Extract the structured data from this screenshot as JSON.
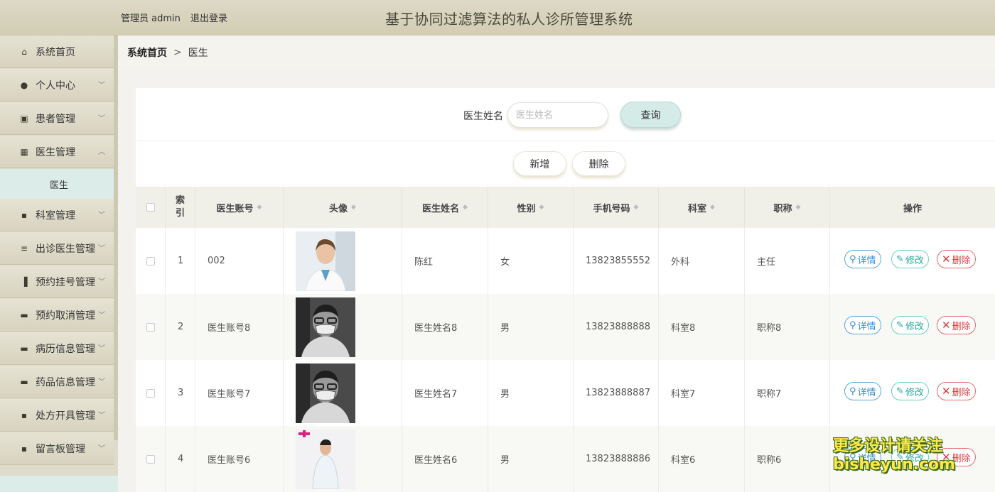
{
  "header": {
    "user_label": "管理员 admin",
    "logout_label": "退出登录",
    "title": "基于协同过滤算法的私人诊所管理系统"
  },
  "sidebar": {
    "items": [
      {
        "label": "系统首页",
        "icon": "home-icon",
        "glyph": "⌂"
      },
      {
        "label": "个人中心",
        "icon": "user-icon",
        "glyph": "●"
      },
      {
        "label": "患者管理",
        "icon": "clipboard-check-icon",
        "glyph": "▣"
      },
      {
        "label": "医生管理",
        "icon": "grid-icon",
        "glyph": "▦"
      },
      {
        "label": "科室管理",
        "icon": "apps-icon",
        "glyph": "▪"
      },
      {
        "label": "出诊医生管理",
        "icon": "list-icon",
        "glyph": "≡"
      },
      {
        "label": "预约挂号管理",
        "icon": "book-icon",
        "glyph": "▐"
      },
      {
        "label": "预约取消管理",
        "icon": "message-icon",
        "glyph": "▬"
      },
      {
        "label": "病历信息管理",
        "icon": "folder-icon",
        "glyph": "▬"
      },
      {
        "label": "药品信息管理",
        "icon": "monitor-icon",
        "glyph": "▬"
      },
      {
        "label": "处方开具管理",
        "icon": "apps-icon",
        "glyph": "▪"
      },
      {
        "label": "留言板管理",
        "icon": "apps-icon",
        "glyph": "▪"
      }
    ],
    "submenu": {
      "label": "医生"
    }
  },
  "breadcrumb": {
    "home": "系统首页",
    "separator": ">",
    "current": "医生"
  },
  "search": {
    "label": "医生姓名",
    "placeholder": "医生姓名",
    "button": "查询"
  },
  "actions": {
    "add": "新增",
    "delete": "删除"
  },
  "table": {
    "headers": {
      "index": "索引",
      "account": "医生账号",
      "avatar": "头像",
      "name": "医生姓名",
      "gender": "性别",
      "phone": "手机号码",
      "dept": "科室",
      "title": "职称",
      "ops": "操作"
    },
    "rows": [
      {
        "index": "1",
        "account": "002",
        "name": "陈红",
        "gender": "女",
        "phone": "13823855552",
        "dept": "外科",
        "title": "主任"
      },
      {
        "index": "2",
        "account": "医生账号8",
        "name": "医生姓名8",
        "gender": "男",
        "phone": "13823888888",
        "dept": "科室8",
        "title": "职称8"
      },
      {
        "index": "3",
        "account": "医生账号7",
        "name": "医生姓名7",
        "gender": "男",
        "phone": "13823888887",
        "dept": "科室7",
        "title": "职称7"
      },
      {
        "index": "4",
        "account": "医生账号6",
        "name": "医生姓名6",
        "gender": "男",
        "phone": "13823888886",
        "dept": "科室6",
        "title": "职称6"
      }
    ],
    "op_labels": {
      "detail": "详情",
      "edit": "修改",
      "delete": "删除"
    }
  },
  "watermark": {
    "line1": "更多设计请关注",
    "line2": "bisheyun.com"
  },
  "colors": {
    "header_bg": "#d2cdb3",
    "sidebar_bg": "#dedbcb",
    "active_sub_bg": "#dcece9",
    "detail": "#3a8fcd",
    "edit": "#2aa99c",
    "delete": "#d93a3a"
  }
}
